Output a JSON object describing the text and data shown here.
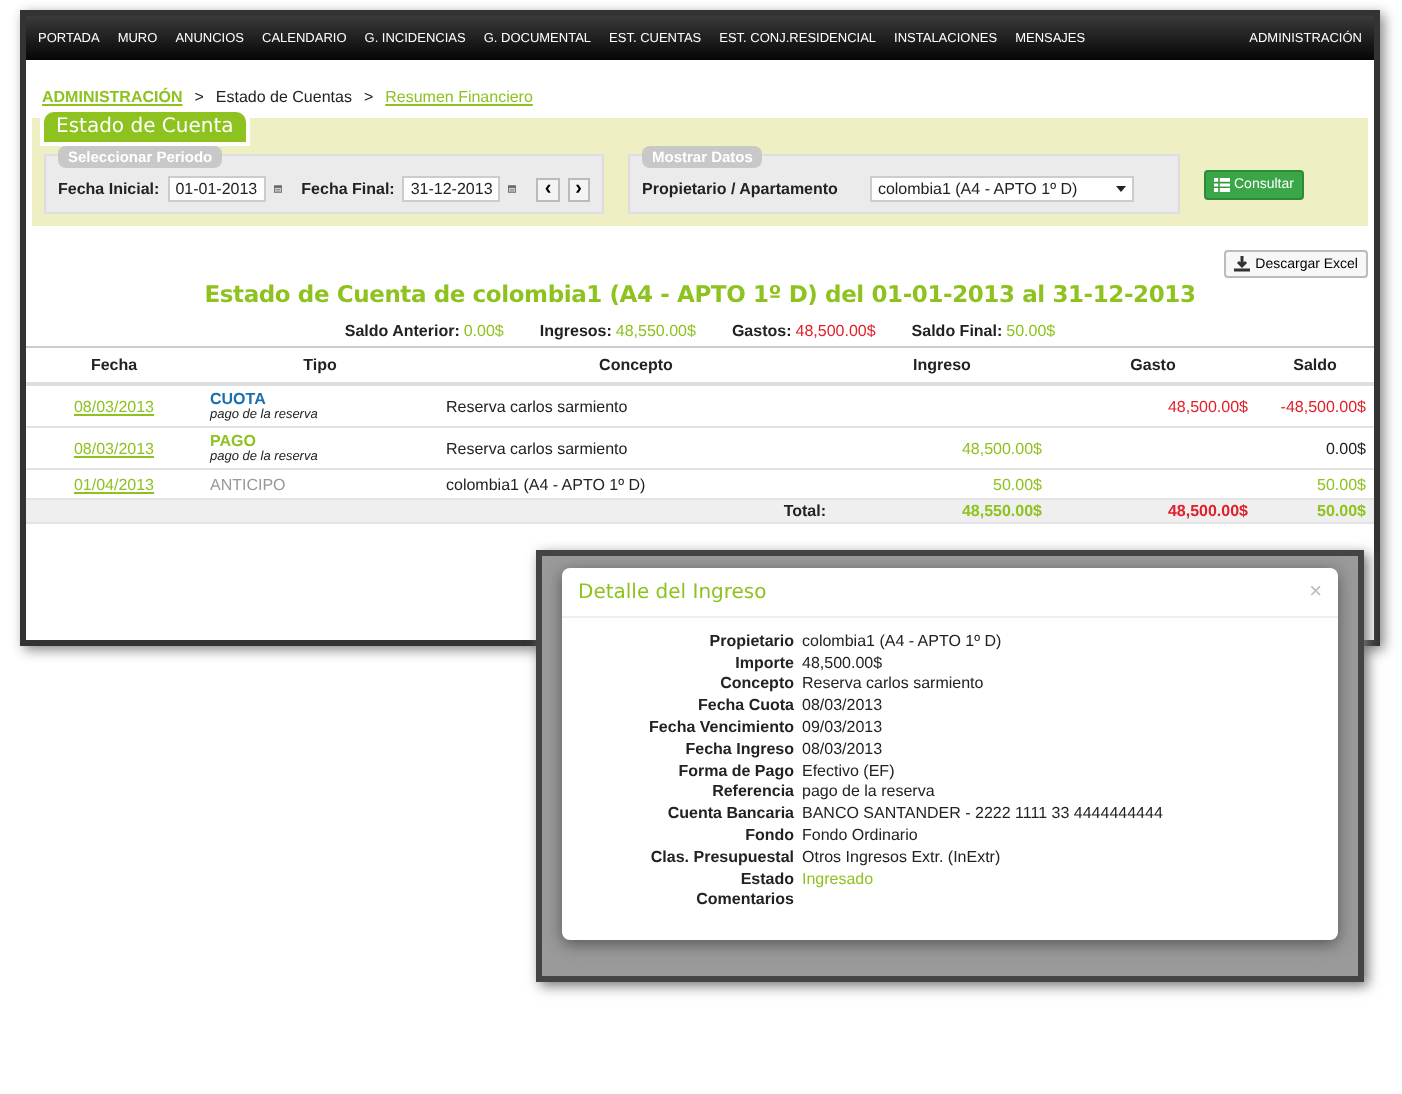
{
  "nav": [
    "PORTADA",
    "MURO",
    "ANUNCIOS",
    "CALENDARIO",
    "G. INCIDENCIAS",
    "G. DOCUMENTAL",
    "EST. CUENTAS",
    "EST. CONJ.RESIDENCIAL",
    "INSTALACIONES",
    "MENSAJES",
    "ADMINISTRACIÓN"
  ],
  "breadcrumb": [
    {
      "text": "ADMINISTRACIÓN",
      "kind": "link"
    },
    {
      "text": ">",
      "kind": "sep"
    },
    {
      "text": "Estado de Cuentas",
      "kind": "current"
    },
    {
      "text": ">",
      "kind": "sep"
    },
    {
      "text": "Resumen Financiero",
      "kind": "link"
    }
  ],
  "panel": {
    "title": "Estado de Cuenta",
    "period": {
      "legend": "Seleccionar Periodo",
      "fields": [
        {
          "label": "Fecha Inicial:",
          "value": "01-01-2013"
        },
        {
          "label": "Fecha Final:",
          "value": "31-12-2013"
        }
      ],
      "prev": "‹",
      "next": "›"
    },
    "data": {
      "legend": "Mostrar Datos",
      "label": "Propietario / Apartamento",
      "value": "colombia1 (A4 - APTO 1º D)"
    },
    "consult_button": "Consultar"
  },
  "excel_button": "Descargar Excel",
  "report_title": "Estado de Cuenta de colombia1 (A4 - APTO 1º D) del 01-01-2013 al 31-12-2013",
  "summary": [
    {
      "label": "Saldo Anterior:",
      "value": "0.00$",
      "kind": "positive"
    },
    {
      "label": "Ingresos:",
      "value": "48,550.00$",
      "kind": "positive"
    },
    {
      "label": "Gastos:",
      "value": "48,500.00$",
      "kind": "negative"
    },
    {
      "label": "Saldo Final:",
      "value": "50.00$",
      "kind": "positive"
    }
  ],
  "table": {
    "columns": [
      "Fecha",
      "Tipo",
      "Concepto",
      "Ingreso",
      "Gasto",
      "Saldo"
    ],
    "rows": [
      {
        "date": "08/03/2013",
        "type": {
          "text": "CUOTA",
          "kind": "cuota"
        },
        "note": "pago de la reserva",
        "concept": "Reserva carlos sarmiento",
        "expense": "48,500.00$",
        "balance": {
          "text": "-48,500.00$",
          "kind": "negative"
        }
      },
      {
        "date": "08/03/2013",
        "type": {
          "text": "PAGO",
          "kind": "pago"
        },
        "note": "pago de la reserva",
        "concept": "Reserva carlos sarmiento",
        "income": "48,500.00$",
        "balance": {
          "text": "0.00$",
          "kind": "neutral"
        }
      },
      {
        "date": "01/04/2013",
        "type": {
          "text": "ANTICIPO",
          "kind": "anticipo"
        },
        "concept": "colombia1 (A4 - APTO 1º D)",
        "income": "50.00$",
        "balance": {
          "text": "50.00$",
          "kind": "positive"
        }
      }
    ],
    "total": {
      "label": "Total:",
      "income": "48,550.00$",
      "expense": "48,500.00$",
      "balance": "50.00$"
    }
  },
  "modal": {
    "title": "Detalle del Ingreso",
    "close": "×",
    "fields": [
      {
        "label": "Propietario",
        "value": "colombia1 (A4 - APTO 1º D)",
        "kind": "text"
      },
      {
        "label": "Importe",
        "value": "48,500.00$",
        "kind": "text"
      },
      {
        "label": "Concepto",
        "value": "Reserva carlos sarmiento",
        "kind": "text"
      },
      {
        "label": "Fecha Cuota",
        "value": "08/03/2013",
        "kind": "text"
      },
      {
        "label": "Fecha Vencimiento",
        "value": "09/03/2013",
        "kind": "text"
      },
      {
        "label": "Fecha Ingreso",
        "value": "08/03/2013",
        "kind": "text"
      },
      {
        "label": "Forma de Pago",
        "value": "Efectivo (EF)",
        "kind": "text"
      },
      {
        "label": "Referencia",
        "value": "pago de la reserva",
        "kind": "text"
      },
      {
        "label": "Cuenta Bancaria",
        "value": "BANCO SANTANDER - 2222 1111 33 4444444444",
        "kind": "text"
      },
      {
        "label": "Fondo",
        "value": "Fondo Ordinario",
        "kind": "text"
      },
      {
        "label": "Clas. Presupuestal",
        "value": "Otros Ingresos Extr. (InExtr)",
        "kind": "text"
      },
      {
        "label": "Estado",
        "value": "Ingresado",
        "kind": "status"
      },
      {
        "label": "Comentarios",
        "kind": "text"
      }
    ]
  }
}
